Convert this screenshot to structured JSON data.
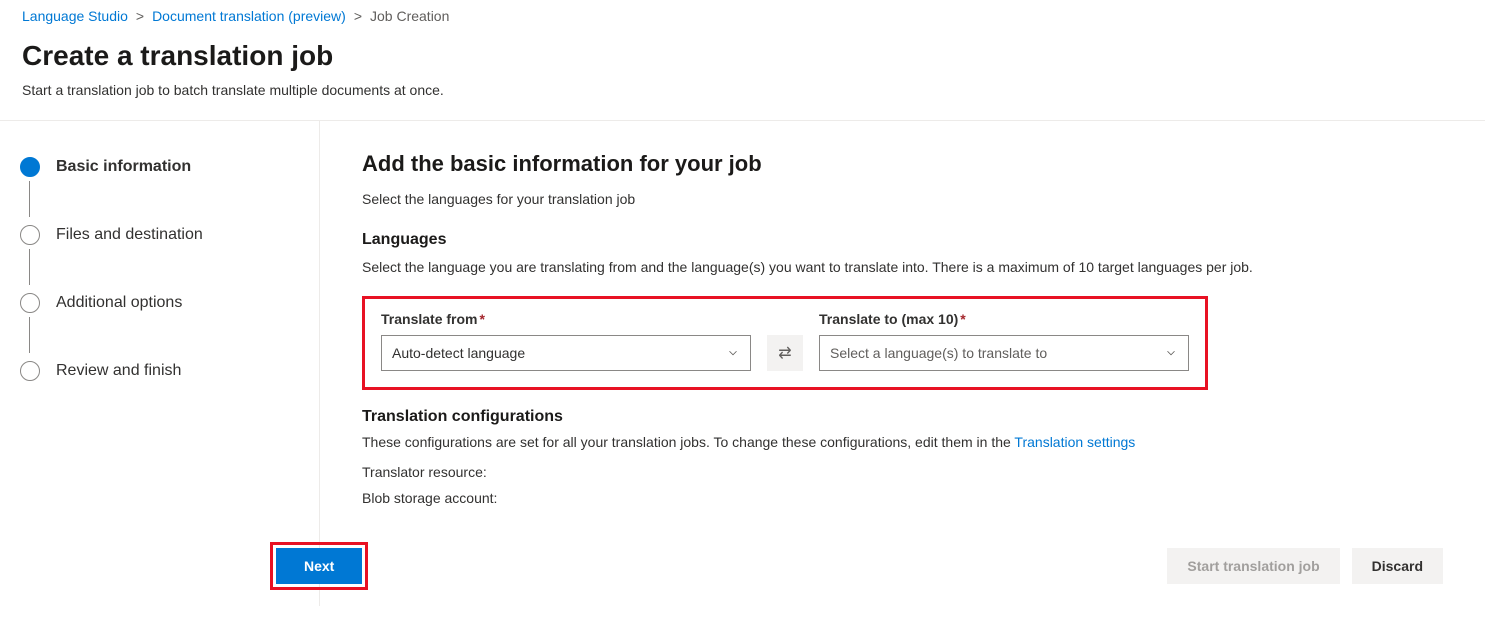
{
  "breadcrumb": {
    "items": [
      {
        "label": "Language Studio"
      },
      {
        "label": "Document translation (preview)"
      }
    ],
    "current": "Job Creation"
  },
  "header": {
    "title": "Create a translation job",
    "subtitle": "Start a translation job to batch translate multiple documents at once."
  },
  "sidebar": {
    "steps": [
      {
        "label": "Basic information"
      },
      {
        "label": "Files and destination"
      },
      {
        "label": "Additional options"
      },
      {
        "label": "Review and finish"
      }
    ]
  },
  "main": {
    "title": "Add the basic information for your job",
    "subtitle": "Select the languages for your translation job",
    "languages": {
      "heading": "Languages",
      "desc": "Select the language you are translating from and the language(s) you want to translate into. There is a maximum of 10 target languages per job.",
      "from_label": "Translate from",
      "from_value": "Auto-detect language",
      "to_label": "Translate to (max 10)",
      "to_placeholder": "Select a language(s) to translate to"
    },
    "config": {
      "heading": "Translation configurations",
      "desc_prefix": "These configurations are set for all your translation jobs. To change these configurations, edit them in the ",
      "desc_link": "Translation settings",
      "resource_label": "Translator resource:",
      "blob_label": "Blob storage account:"
    }
  },
  "footer": {
    "next": "Next",
    "start": "Start translation job",
    "discard": "Discard"
  }
}
